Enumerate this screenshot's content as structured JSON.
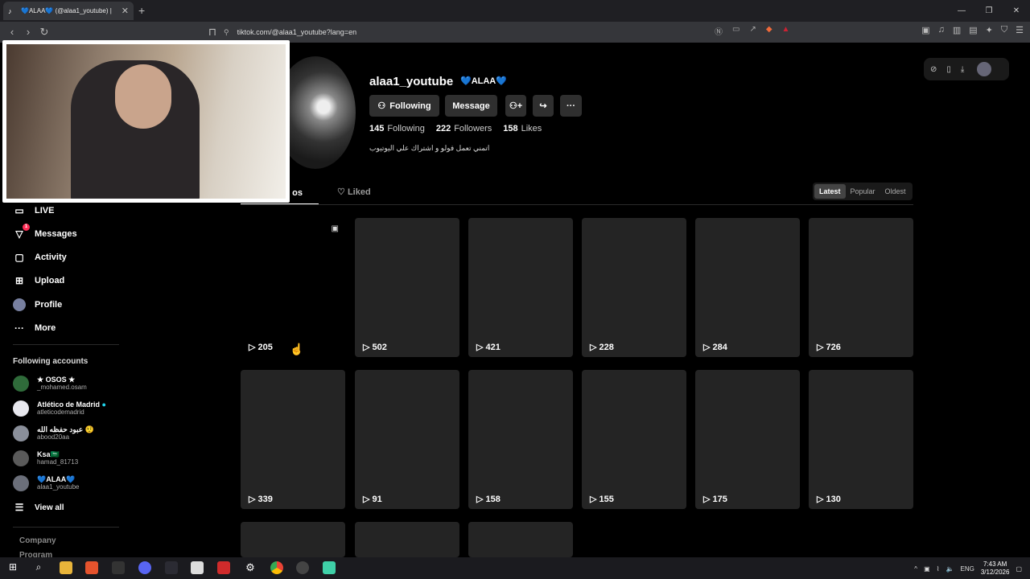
{
  "browser": {
    "tab_title": "💙ALAA💙 (@alaa1_youtube) |",
    "url": "tiktok.com/@alaa1_youtube?lang=en"
  },
  "sidebar": {
    "items": [
      {
        "label": "LIVE",
        "icon": "live-icon"
      },
      {
        "label": "Messages",
        "icon": "messages-icon",
        "badge": "1"
      },
      {
        "label": "Activity",
        "icon": "activity-icon"
      },
      {
        "label": "Upload",
        "icon": "upload-icon"
      },
      {
        "label": "Profile",
        "icon": "profile-icon"
      },
      {
        "label": "More",
        "icon": "more-icon"
      }
    ],
    "following_title": "Following accounts",
    "accounts": [
      {
        "name": "★ OSOS ★",
        "handle": "_mohamed.osam"
      },
      {
        "name": "Atlético de Madrid",
        "handle": "atleticodemadrid"
      },
      {
        "name": "عبود حفظه الله 🤨",
        "handle": "abood20aa"
      },
      {
        "name": "Ksa🇸🇦",
        "handle": "hamad_81713"
      },
      {
        "name": "💙ALAA💙",
        "handle": "alaa1_youtube"
      }
    ],
    "view_all": "View all",
    "footer": [
      "Company",
      "Program"
    ]
  },
  "profile": {
    "username": "alaa1_youtube",
    "nickname": "💙ALAA💙",
    "following_button": "Following",
    "message_button": "Message",
    "stats": {
      "following_count": "145",
      "following_label": "Following",
      "followers_count": "222",
      "followers_label": "Followers",
      "likes_count": "158",
      "likes_label": "Likes"
    },
    "bio": "اتمني تعمل فولو و اشتراك علي اليوتيوب"
  },
  "tabs": {
    "videos": "os",
    "liked": "Liked"
  },
  "sort": [
    "Latest",
    "Popular",
    "Oldest"
  ],
  "videos": [
    {
      "views": "205"
    },
    {
      "views": "502"
    },
    {
      "views": "421"
    },
    {
      "views": "228"
    },
    {
      "views": "284"
    },
    {
      "views": "726"
    },
    {
      "views": "339"
    },
    {
      "views": "91"
    },
    {
      "views": "158"
    },
    {
      "views": "155"
    },
    {
      "views": "175"
    },
    {
      "views": "130"
    }
  ],
  "taskbar": {
    "language": "ENG",
    "time": "7:43 AM",
    "date": "3/12/2026"
  },
  "colors": {
    "accent": "#fe2c55",
    "card": "#242424"
  }
}
